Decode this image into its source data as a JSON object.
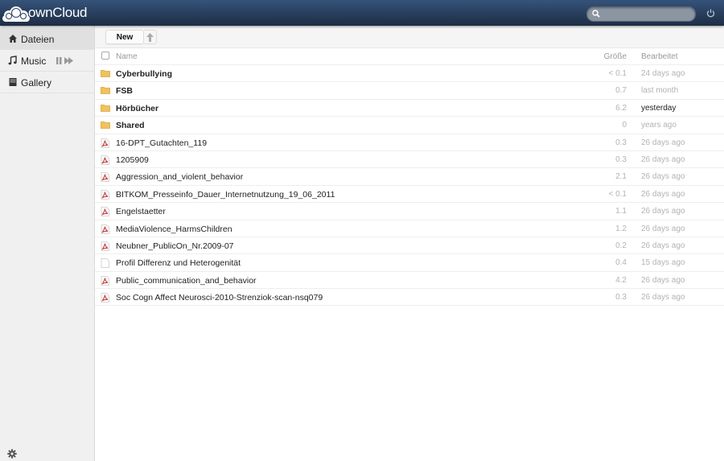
{
  "header": {
    "logo_text": "ownCloud",
    "search": {
      "value": "",
      "placeholder": ""
    }
  },
  "nav": {
    "items": [
      {
        "label": "Dateien",
        "icon": "home-icon",
        "active": true
      },
      {
        "label": "Music",
        "icon": "music-note-icon",
        "active": false
      },
      {
        "label": "Gallery",
        "icon": "image-icon",
        "active": false
      }
    ]
  },
  "controls": {
    "new_label": "New"
  },
  "table": {
    "columns": {
      "name": "Name",
      "size": "Größe",
      "modified": "Bearbeitet"
    },
    "rows": [
      {
        "name": "Cyberbullying",
        "type": "folder",
        "size": "< 0.1",
        "modified": "24 days ago"
      },
      {
        "name": "FSB",
        "type": "folder",
        "size": "0.7",
        "modified": "last month"
      },
      {
        "name": "Hörbücher",
        "type": "folder",
        "size": "6.2",
        "modified": "yesterday"
      },
      {
        "name": "Shared",
        "type": "folder",
        "size": "0",
        "modified": "years ago"
      },
      {
        "name": "16-DPT_Gutachten_119",
        "type": "pdf",
        "size": "0.3",
        "modified": "26 days ago"
      },
      {
        "name": "1205909",
        "type": "pdf",
        "size": "0.3",
        "modified": "26 days ago"
      },
      {
        "name": "Aggression_and_violent_behavior",
        "type": "pdf",
        "size": "2.1",
        "modified": "26 days ago"
      },
      {
        "name": "BITKOM_Presseinfo_Dauer_Internetnutzung_19_06_2011",
        "type": "pdf",
        "size": "< 0.1",
        "modified": "26 days ago"
      },
      {
        "name": "Engelstaetter",
        "type": "pdf",
        "size": "1.1",
        "modified": "26 days ago"
      },
      {
        "name": "MediaViolence_HarmsChildren",
        "type": "pdf",
        "size": "1.2",
        "modified": "26 days ago"
      },
      {
        "name": "Neubner_PublicOn_Nr.2009-07",
        "type": "pdf",
        "size": "0.2",
        "modified": "26 days ago"
      },
      {
        "name": "Profil Differenz und Heterogenität",
        "type": "document",
        "size": "0.4",
        "modified": "15 days ago"
      },
      {
        "name": "Public_communication_and_behavior",
        "type": "pdf",
        "size": "4.2",
        "modified": "26 days ago"
      },
      {
        "name": "Soc Cogn Affect Neurosci-2010-Strenziok-scan-nsq079",
        "type": "pdf",
        "size": "0.3",
        "modified": "26 days ago"
      }
    ]
  },
  "colors": {
    "header_top": "#35537a",
    "header_bottom": "#1d2d44",
    "folder": "#f2c25a",
    "pdf_red": "#c9302c"
  }
}
